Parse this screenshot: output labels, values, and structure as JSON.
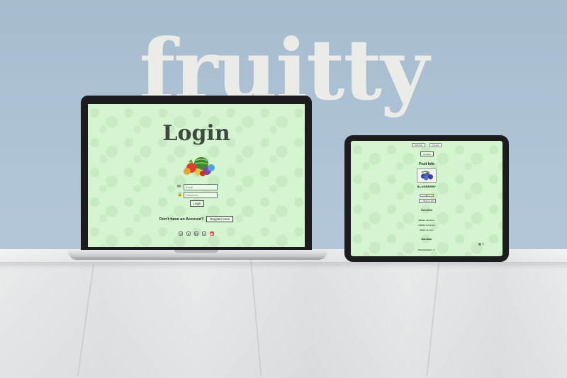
{
  "brand": {
    "name": "fruitty"
  },
  "laptop": {
    "title": "Login",
    "email_placeholder": "Email",
    "password_placeholder": "Password",
    "login_button": "Login",
    "account_text": "Don't have an Account?",
    "register_button": "Register Here",
    "social_icons": [
      "instagram-icon",
      "github-icon",
      "linkedin-icon",
      "link-icon",
      "youtube-icon"
    ]
  },
  "tablet": {
    "nav": [
      "Edit Card",
      "Log out"
    ],
    "back_button": "Go Back",
    "title": "Fruit Info",
    "fruit_name": "BLUEBERRY",
    "show_button": "♡ Show on Info",
    "overview_heading": "Overview",
    "genus_label": "Genus:",
    "genus_value": "Vaccinium",
    "family_label": "Family:",
    "family_value": "Ericaceae",
    "order_label": "Order:",
    "order_value": "Ericales",
    "nutrition_heading": "Nutrition",
    "carbs_label": "Carbohydrates:",
    "carbs_value": "17"
  },
  "colors": {
    "wall": "#a9bfd2",
    "screen": "#d4f5d0",
    "title": "#3e4a40",
    "brand": "#ebebe8"
  }
}
